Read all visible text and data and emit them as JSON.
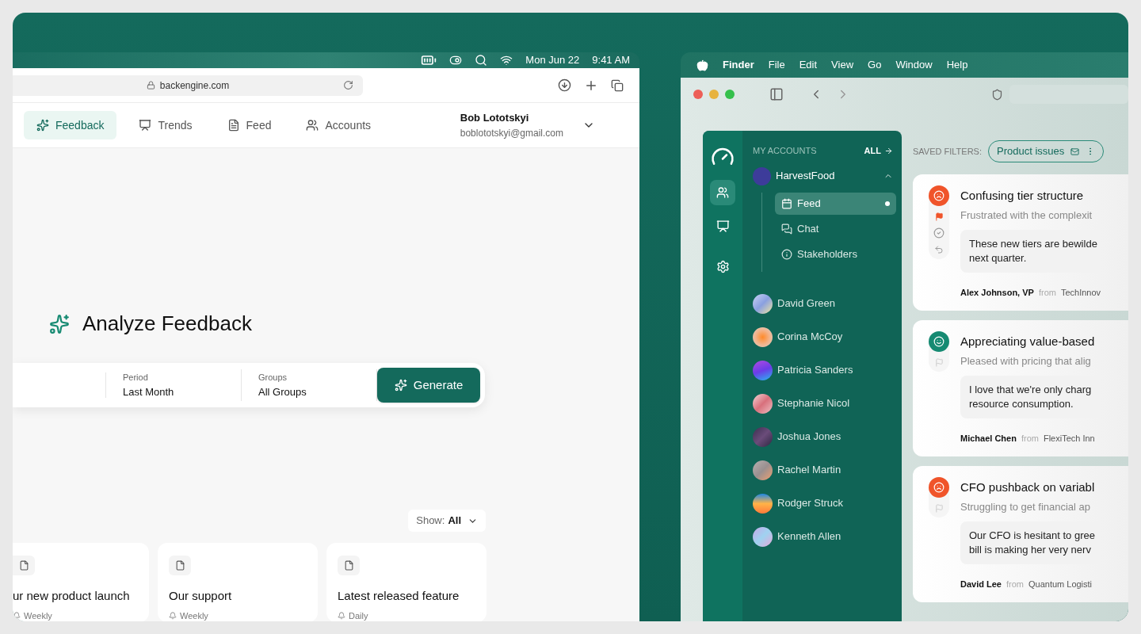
{
  "left_screen": {
    "menu_bar": {
      "date": "Mon Jun 22",
      "time": "9:41 AM"
    },
    "browser": {
      "address": "backengine.com"
    },
    "nav": {
      "tabs": [
        {
          "label": "Feedback",
          "selected": true,
          "kind": "sparkle"
        },
        {
          "label": "Trends",
          "selected": false,
          "kind": "chart"
        },
        {
          "label": "Feed",
          "selected": false,
          "kind": "document"
        },
        {
          "label": "Accounts",
          "selected": false,
          "kind": "people"
        }
      ],
      "user": {
        "name": "Bob Lototskyi",
        "email": "boblototskyi@gmail.com"
      }
    },
    "hero": {
      "title": "Analyze Feedback"
    },
    "filters": [
      {
        "label": "Period",
        "value": "Last Month"
      },
      {
        "label": "Groups",
        "value": "All Groups"
      }
    ],
    "generate_button": "Generate",
    "show_filter": {
      "label": "Show:",
      "value": "All"
    },
    "reports": [
      {
        "title": "ur new product launch",
        "frequency": "Weekly"
      },
      {
        "title": "Our support",
        "frequency": "Weekly"
      },
      {
        "title": "Latest released feature",
        "frequency": "Daily"
      }
    ]
  },
  "right_screen": {
    "menu_bar": {
      "app": "Finder",
      "items": [
        "File",
        "Edit",
        "View",
        "Go",
        "Window",
        "Help"
      ]
    },
    "sidebar": {
      "heading": "MY ACCOUNTS",
      "all_link": "ALL",
      "account": {
        "name": "HarvestFood",
        "expanded": true,
        "children": [
          {
            "label": "Feed",
            "selected": true,
            "kind": "feed"
          },
          {
            "label": "Chat",
            "selected": false,
            "kind": "chat"
          },
          {
            "label": "Stakeholders",
            "selected": false,
            "kind": "info"
          }
        ]
      },
      "people": [
        "David Green",
        "Corina McCoy",
        "Patricia Sanders",
        "Stephanie Nicol",
        "Joshua Jones",
        "Rachel Martin",
        "Rodger Struck",
        "Kenneth Allen"
      ]
    },
    "saved_filters": {
      "label": "SAVED FILTERS:",
      "chip": "Product issues"
    },
    "feedback": [
      {
        "negative": true,
        "flagged": true,
        "extra_actions": true,
        "title": "Confusing tier structure",
        "summary": "Frustrated with the complexit",
        "quote": "These new tiers are bewilde next quarter.",
        "author": "Alex Johnson, VP",
        "from": "from",
        "company": "TechInnov"
      },
      {
        "negative": false,
        "flagged": false,
        "extra_actions": false,
        "title": "Appreciating value-based",
        "summary": "Pleased with pricing that alig",
        "quote": "I love that we're only charg resource consumption.",
        "author": "Michael Chen",
        "from": "from",
        "company": "FlexiTech Inn"
      },
      {
        "negative": true,
        "flagged": false,
        "extra_actions": false,
        "title": "CFO pushback on variabl",
        "summary": "Struggling to get financial ap",
        "quote": "Our CFO is hesitant to gree bill is making her very nerv",
        "author": "David Lee",
        "from": "from",
        "company": "Quantum Logisti"
      }
    ]
  }
}
